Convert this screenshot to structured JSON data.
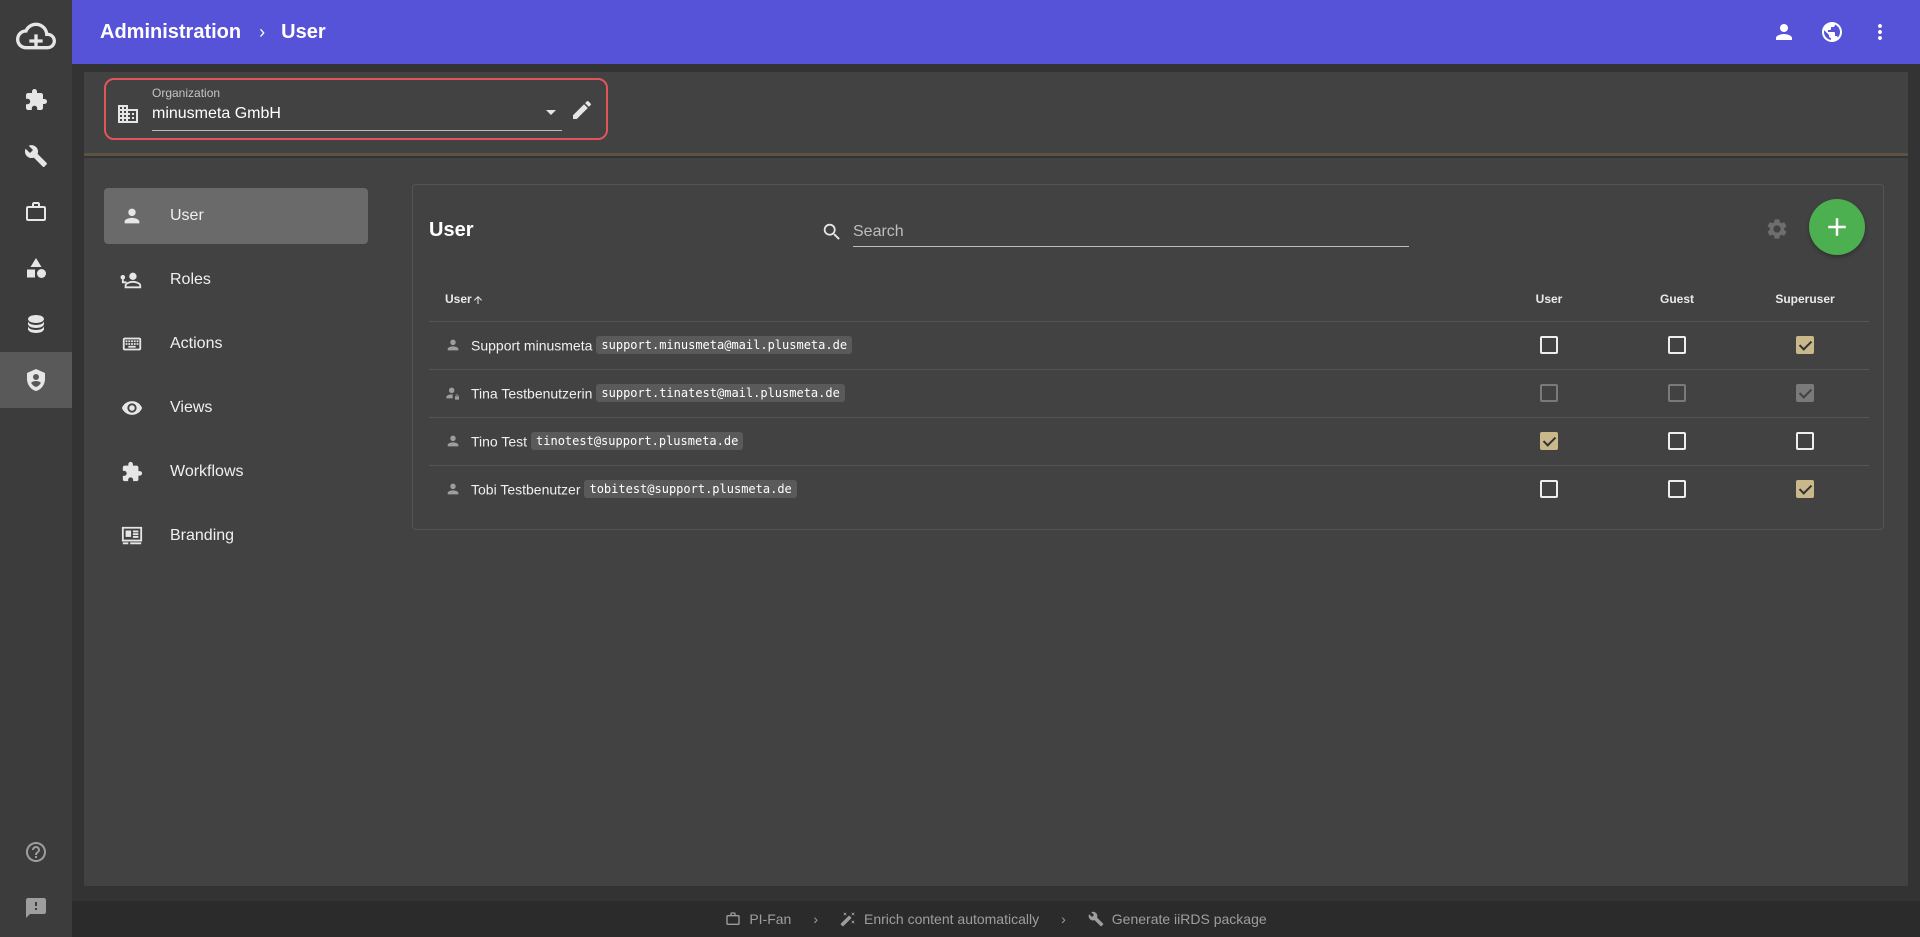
{
  "topbar": {
    "breadcrumb_root": "Administration",
    "breadcrumb_sep": "›",
    "breadcrumb_current": "User"
  },
  "organization": {
    "label": "Organization",
    "value": "minusmeta GmbH"
  },
  "nav": {
    "items": [
      {
        "label": "User",
        "icon": "person-icon",
        "active": true
      },
      {
        "label": "Roles",
        "icon": "roles-icon",
        "active": false
      },
      {
        "label": "Actions",
        "icon": "keyboard-icon",
        "active": false
      },
      {
        "label": "Views",
        "icon": "eye-icon",
        "active": false
      },
      {
        "label": "Workflows",
        "icon": "puzzle-icon",
        "active": false
      },
      {
        "label": "Branding",
        "icon": "branding-icon",
        "active": false
      }
    ]
  },
  "card": {
    "title": "User",
    "search_placeholder": "Search"
  },
  "table": {
    "columns": [
      "User",
      "User",
      "Guest",
      "Superuser"
    ],
    "rows": [
      {
        "name": "Support minusmeta",
        "email": "support.minusmeta@mail.plusmeta.de",
        "user": false,
        "guest": false,
        "superuser": true,
        "disabled": false
      },
      {
        "name": "Tina Testbenutzerin",
        "email": "support.tinatest@mail.plusmeta.de",
        "user": false,
        "guest": false,
        "superuser": true,
        "disabled": true
      },
      {
        "name": "Tino Test",
        "email": "tinotest@support.plusmeta.de",
        "user": true,
        "guest": false,
        "superuser": false,
        "disabled": false
      },
      {
        "name": "Tobi Testbenutzer",
        "email": "tobitest@support.plusmeta.de",
        "user": false,
        "guest": false,
        "superuser": true,
        "disabled": false
      }
    ]
  },
  "footer": {
    "items": [
      "PI-Fan",
      "Enrich content automatically",
      "Generate iiRDS package"
    ],
    "sep": "›"
  },
  "colors": {
    "topbar": "#5653d8",
    "fab": "#4caf50",
    "checked": "#c9b98a",
    "highlight_border": "#e0555a"
  }
}
